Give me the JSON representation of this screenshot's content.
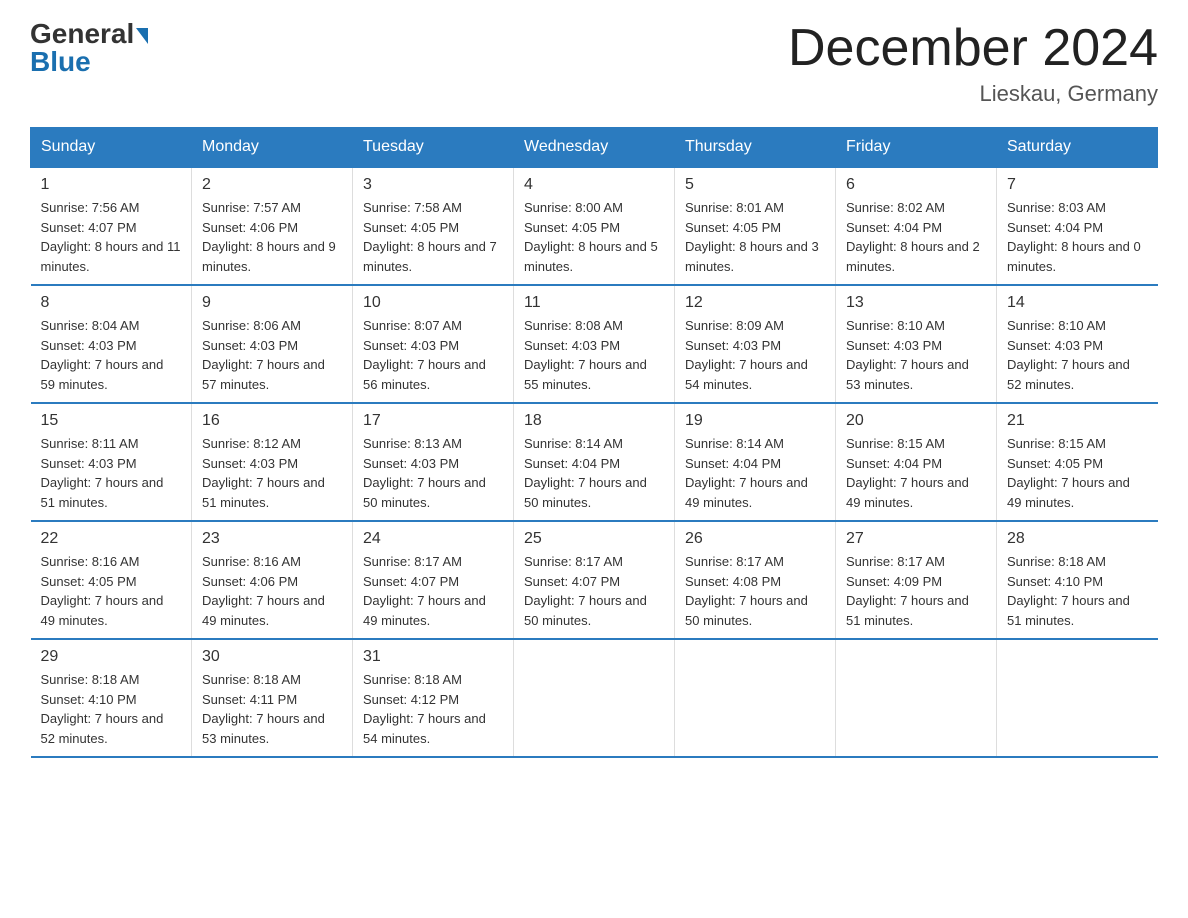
{
  "header": {
    "logo_line1": "General",
    "logo_line2": "Blue",
    "title": "December 2024",
    "subtitle": "Lieskau, Germany"
  },
  "days_of_week": [
    "Sunday",
    "Monday",
    "Tuesday",
    "Wednesday",
    "Thursday",
    "Friday",
    "Saturday"
  ],
  "weeks": [
    [
      {
        "num": "1",
        "sunrise": "7:56 AM",
        "sunset": "4:07 PM",
        "daylight": "8 hours and 11 minutes."
      },
      {
        "num": "2",
        "sunrise": "7:57 AM",
        "sunset": "4:06 PM",
        "daylight": "8 hours and 9 minutes."
      },
      {
        "num": "3",
        "sunrise": "7:58 AM",
        "sunset": "4:05 PM",
        "daylight": "8 hours and 7 minutes."
      },
      {
        "num": "4",
        "sunrise": "8:00 AM",
        "sunset": "4:05 PM",
        "daylight": "8 hours and 5 minutes."
      },
      {
        "num": "5",
        "sunrise": "8:01 AM",
        "sunset": "4:05 PM",
        "daylight": "8 hours and 3 minutes."
      },
      {
        "num": "6",
        "sunrise": "8:02 AM",
        "sunset": "4:04 PM",
        "daylight": "8 hours and 2 minutes."
      },
      {
        "num": "7",
        "sunrise": "8:03 AM",
        "sunset": "4:04 PM",
        "daylight": "8 hours and 0 minutes."
      }
    ],
    [
      {
        "num": "8",
        "sunrise": "8:04 AM",
        "sunset": "4:03 PM",
        "daylight": "7 hours and 59 minutes."
      },
      {
        "num": "9",
        "sunrise": "8:06 AM",
        "sunset": "4:03 PM",
        "daylight": "7 hours and 57 minutes."
      },
      {
        "num": "10",
        "sunrise": "8:07 AM",
        "sunset": "4:03 PM",
        "daylight": "7 hours and 56 minutes."
      },
      {
        "num": "11",
        "sunrise": "8:08 AM",
        "sunset": "4:03 PM",
        "daylight": "7 hours and 55 minutes."
      },
      {
        "num": "12",
        "sunrise": "8:09 AM",
        "sunset": "4:03 PM",
        "daylight": "7 hours and 54 minutes."
      },
      {
        "num": "13",
        "sunrise": "8:10 AM",
        "sunset": "4:03 PM",
        "daylight": "7 hours and 53 minutes."
      },
      {
        "num": "14",
        "sunrise": "8:10 AM",
        "sunset": "4:03 PM",
        "daylight": "7 hours and 52 minutes."
      }
    ],
    [
      {
        "num": "15",
        "sunrise": "8:11 AM",
        "sunset": "4:03 PM",
        "daylight": "7 hours and 51 minutes."
      },
      {
        "num": "16",
        "sunrise": "8:12 AM",
        "sunset": "4:03 PM",
        "daylight": "7 hours and 51 minutes."
      },
      {
        "num": "17",
        "sunrise": "8:13 AM",
        "sunset": "4:03 PM",
        "daylight": "7 hours and 50 minutes."
      },
      {
        "num": "18",
        "sunrise": "8:14 AM",
        "sunset": "4:04 PM",
        "daylight": "7 hours and 50 minutes."
      },
      {
        "num": "19",
        "sunrise": "8:14 AM",
        "sunset": "4:04 PM",
        "daylight": "7 hours and 49 minutes."
      },
      {
        "num": "20",
        "sunrise": "8:15 AM",
        "sunset": "4:04 PM",
        "daylight": "7 hours and 49 minutes."
      },
      {
        "num": "21",
        "sunrise": "8:15 AM",
        "sunset": "4:05 PM",
        "daylight": "7 hours and 49 minutes."
      }
    ],
    [
      {
        "num": "22",
        "sunrise": "8:16 AM",
        "sunset": "4:05 PM",
        "daylight": "7 hours and 49 minutes."
      },
      {
        "num": "23",
        "sunrise": "8:16 AM",
        "sunset": "4:06 PM",
        "daylight": "7 hours and 49 minutes."
      },
      {
        "num": "24",
        "sunrise": "8:17 AM",
        "sunset": "4:07 PM",
        "daylight": "7 hours and 49 minutes."
      },
      {
        "num": "25",
        "sunrise": "8:17 AM",
        "sunset": "4:07 PM",
        "daylight": "7 hours and 50 minutes."
      },
      {
        "num": "26",
        "sunrise": "8:17 AM",
        "sunset": "4:08 PM",
        "daylight": "7 hours and 50 minutes."
      },
      {
        "num": "27",
        "sunrise": "8:17 AM",
        "sunset": "4:09 PM",
        "daylight": "7 hours and 51 minutes."
      },
      {
        "num": "28",
        "sunrise": "8:18 AM",
        "sunset": "4:10 PM",
        "daylight": "7 hours and 51 minutes."
      }
    ],
    [
      {
        "num": "29",
        "sunrise": "8:18 AM",
        "sunset": "4:10 PM",
        "daylight": "7 hours and 52 minutes."
      },
      {
        "num": "30",
        "sunrise": "8:18 AM",
        "sunset": "4:11 PM",
        "daylight": "7 hours and 53 minutes."
      },
      {
        "num": "31",
        "sunrise": "8:18 AM",
        "sunset": "4:12 PM",
        "daylight": "7 hours and 54 minutes."
      },
      {
        "num": "",
        "sunrise": "",
        "sunset": "",
        "daylight": ""
      },
      {
        "num": "",
        "sunrise": "",
        "sunset": "",
        "daylight": ""
      },
      {
        "num": "",
        "sunrise": "",
        "sunset": "",
        "daylight": ""
      },
      {
        "num": "",
        "sunrise": "",
        "sunset": "",
        "daylight": ""
      }
    ]
  ]
}
